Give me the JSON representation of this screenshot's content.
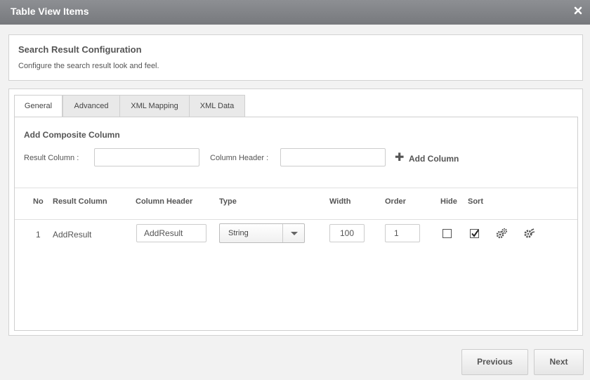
{
  "window": {
    "title": "Table View Items",
    "close_icon": "close-icon"
  },
  "config": {
    "heading": "Search Result Configuration",
    "description": "Configure the search result look and feel."
  },
  "tabs": [
    {
      "label": "General",
      "active": true
    },
    {
      "label": "Advanced",
      "active": false
    },
    {
      "label": "XML Mapping",
      "active": false
    },
    {
      "label": "XML Data",
      "active": false
    }
  ],
  "composite": {
    "title": "Add Composite Column",
    "result_column_label": "Result Column :",
    "result_column_value": "",
    "column_header_label": "Column Header :",
    "column_header_value": "",
    "add_button": "Add Column",
    "add_icon": "plus-icon"
  },
  "table": {
    "headers": [
      "No",
      "Result Column",
      "Column Header",
      "Type",
      "Width",
      "Order",
      "Hide",
      "Sort"
    ],
    "rows": [
      {
        "no": "1",
        "result_column": "AddResult",
        "column_header": "AddResult",
        "type": "String",
        "width": "100",
        "order": "1",
        "hide": false,
        "sort": true,
        "action_icons": [
          "gears-icon",
          "gear-settings-icon"
        ]
      }
    ]
  },
  "buttons": {
    "previous": "Previous",
    "next": "Next"
  }
}
